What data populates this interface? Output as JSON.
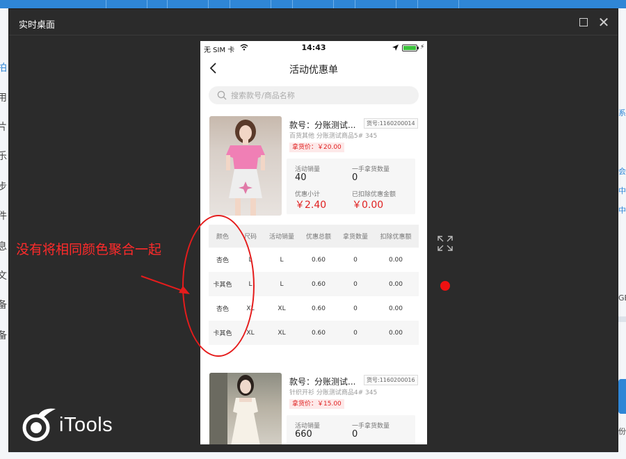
{
  "background_app": {
    "left_menu_chars": [
      "拍",
      "用",
      "片",
      "乐",
      "步",
      "件",
      "息",
      "文",
      "备",
      "备"
    ],
    "right_links": [
      "系",
      "会",
      "中",
      "中"
    ],
    "right_text": [
      "GB",
      "份"
    ]
  },
  "window": {
    "title": "实时桌面",
    "annotation": "没有将相同颜色聚合一起",
    "brand": "iTools"
  },
  "phone": {
    "status": {
      "carrier": "无 SIM 卡",
      "time": "14:43",
      "charge": "⚡"
    },
    "nav_title": "活动优惠单",
    "search": {
      "placeholder": "搜索款号/商品名称"
    },
    "items": [
      {
        "title": "款号：分账测试...",
        "sku": "货号:1160200014",
        "subtitle": "百货其他  分账测试商品5#  345",
        "price": "拿货价：￥20.00",
        "stats": {
          "sales_label": "活动销量",
          "sales_value": "40",
          "first_hand_label": "一手拿货数量",
          "first_hand_value": "0",
          "subtotal_label": "优惠小计",
          "subtotal_value": "￥2.40",
          "deducted_label": "已扣除优惠金额",
          "deducted_value": "￥0.00"
        },
        "table": {
          "headers": [
            "颜色",
            "尺码",
            "活动销量",
            "优惠总额",
            "拿货数量",
            "扣除优惠额"
          ],
          "rows": [
            [
              "杏色",
              "L",
              "L",
              "0.60",
              "0",
              "0.00"
            ],
            [
              "卡其色",
              "L",
              "L",
              "0.60",
              "0",
              "0.00"
            ],
            [
              "杏色",
              "XL",
              "XL",
              "0.60",
              "0",
              "0.00"
            ],
            [
              "卡其色",
              "XL",
              "XL",
              "0.60",
              "0",
              "0.00"
            ]
          ]
        }
      },
      {
        "title": "款号：分账测试...",
        "sku": "货号:1160200016",
        "subtitle": "针织开衫  分账测试商品4#  345",
        "price": "拿货价：￥15.00",
        "stats": {
          "sales_label": "活动销量",
          "sales_value": "660",
          "first_hand_label": "一手拿货数量",
          "first_hand_value": "0"
        }
      }
    ]
  },
  "colors": {
    "accent_red": "#e02020",
    "annotation_red": "#ff2b2b",
    "window_bg": "#2b2b2b",
    "app_blue": "#2f86d6"
  }
}
